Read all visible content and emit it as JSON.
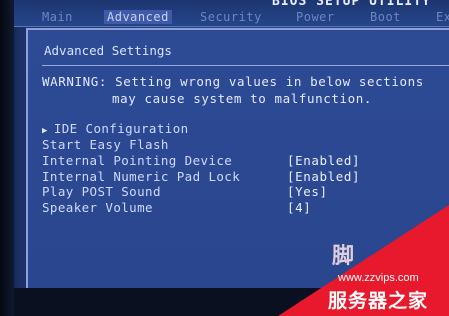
{
  "bios": {
    "title": "BIOS SETUP UTILITY",
    "tabs": [
      "Main",
      "Advanced",
      "Security",
      "Power",
      "Boot",
      "Exit"
    ],
    "active_tab": "Advanced"
  },
  "panel": {
    "title": "Advanced Settings",
    "warning_line1": "WARNING: Setting wrong values in below sections",
    "warning_line2": "may cause system to malfunction.",
    "items": [
      {
        "label": "IDE Configuration",
        "value": "",
        "submenu": true
      },
      {
        "label": "Start Easy Flash",
        "value": ""
      },
      {
        "label": "Internal Pointing Device",
        "value": "[Enabled]"
      },
      {
        "label": "Internal Numeric Pad Lock",
        "value": "[Enabled]"
      },
      {
        "label": "Play POST Sound",
        "value": "[Yes]"
      },
      {
        "label": "Speaker Volume",
        "value": "[4]"
      }
    ]
  },
  "watermark": {
    "site_url": "www.zzvips.com",
    "site_name": "服务器之家",
    "partial_glyph": "脚",
    "color": "#e8192c"
  },
  "colors": {
    "bios_blue": "#2a468e",
    "text": "#cfd9ff"
  }
}
